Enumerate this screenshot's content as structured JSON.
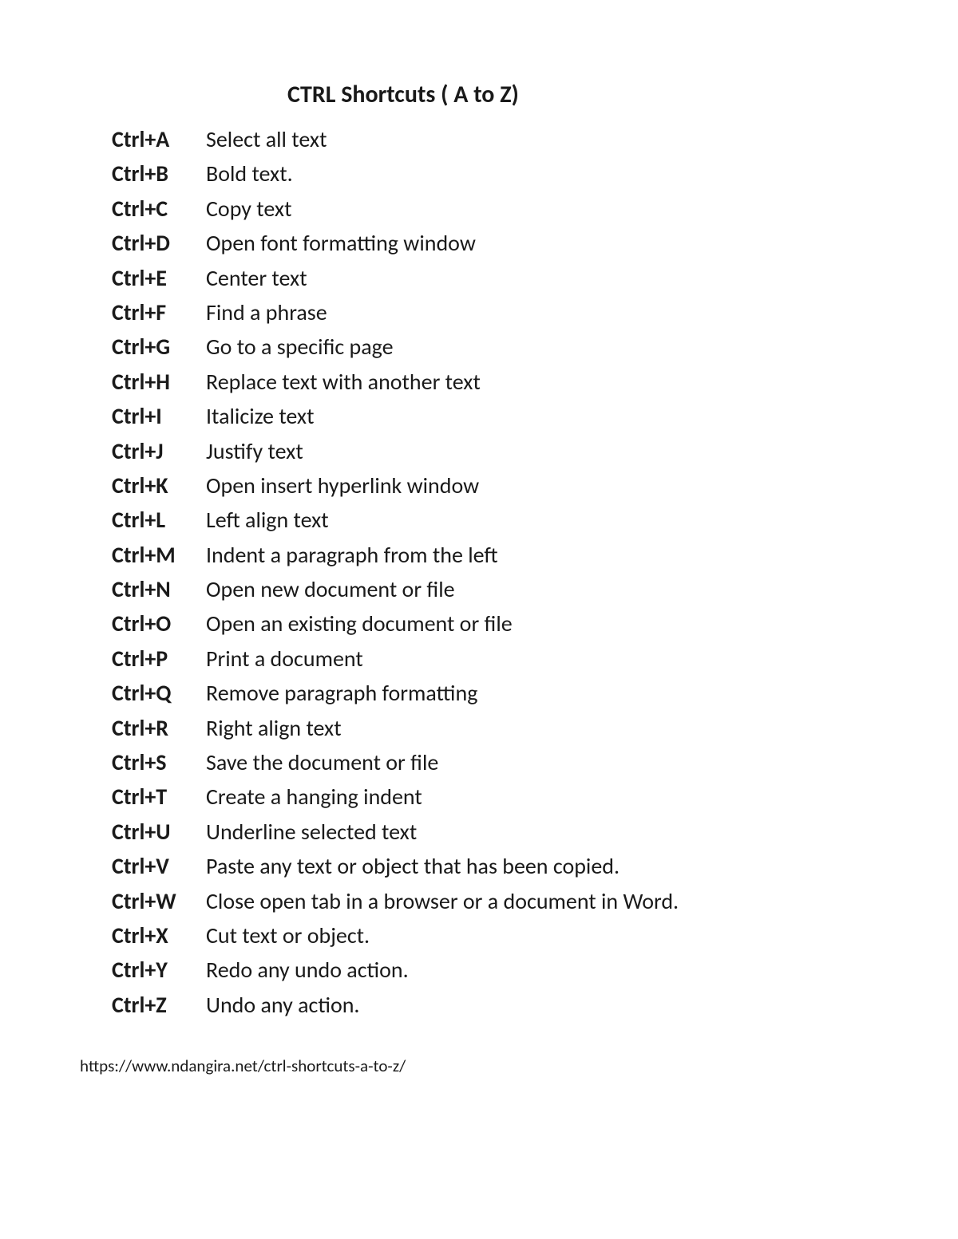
{
  "title": "CTRL Shortcuts ( A to Z)",
  "shortcuts": [
    {
      "key": "Ctrl+A",
      "desc": "Select all text"
    },
    {
      "key": "Ctrl+B",
      "desc": "Bold text."
    },
    {
      "key": "Ctrl+C",
      "desc": "Copy text"
    },
    {
      "key": "Ctrl+D",
      "desc": "Open font formatting window"
    },
    {
      "key": "Ctrl+E",
      "desc": "Center text"
    },
    {
      "key": "Ctrl+F",
      "desc": "Find a phrase"
    },
    {
      "key": "Ctrl+G",
      "desc": "Go to a specific page"
    },
    {
      "key": "Ctrl+H",
      "desc": "Replace text with another text"
    },
    {
      "key": "Ctrl+I",
      "desc": "Italicize text"
    },
    {
      "key": "Ctrl+J",
      "desc": "Justify text"
    },
    {
      "key": "Ctrl+K",
      "desc": "Open insert hyperlink window"
    },
    {
      "key": "Ctrl+L",
      "desc": "Left align text"
    },
    {
      "key": "Ctrl+M",
      "desc": "Indent a paragraph from the left"
    },
    {
      "key": "Ctrl+N",
      "desc": "Open new document or file"
    },
    {
      "key": "Ctrl+O",
      "desc": "Open an existing document or file"
    },
    {
      "key": "Ctrl+P",
      "desc": "Print a document"
    },
    {
      "key": "Ctrl+Q",
      "desc": "Remove paragraph formatting"
    },
    {
      "key": "Ctrl+R",
      "desc": "Right align text"
    },
    {
      "key": "Ctrl+S",
      "desc": "Save the document or file"
    },
    {
      "key": "Ctrl+T",
      "desc": "Create a hanging indent"
    },
    {
      "key": "Ctrl+U",
      "desc": "Underline selected text"
    },
    {
      "key": "Ctrl+V",
      "desc": "Paste any text or object that has been copied."
    },
    {
      "key": "Ctrl+W",
      "desc": "Close open tab in a browser or a document in Word."
    },
    {
      "key": "Ctrl+X",
      "desc": "Cut text or object."
    },
    {
      "key": "Ctrl+Y",
      "desc": " Redo any undo action."
    },
    {
      "key": "Ctrl+Z",
      "desc": "Undo any action."
    }
  ],
  "footer": "https://www.ndangira.net/ctrl-shortcuts-a-to-z/"
}
